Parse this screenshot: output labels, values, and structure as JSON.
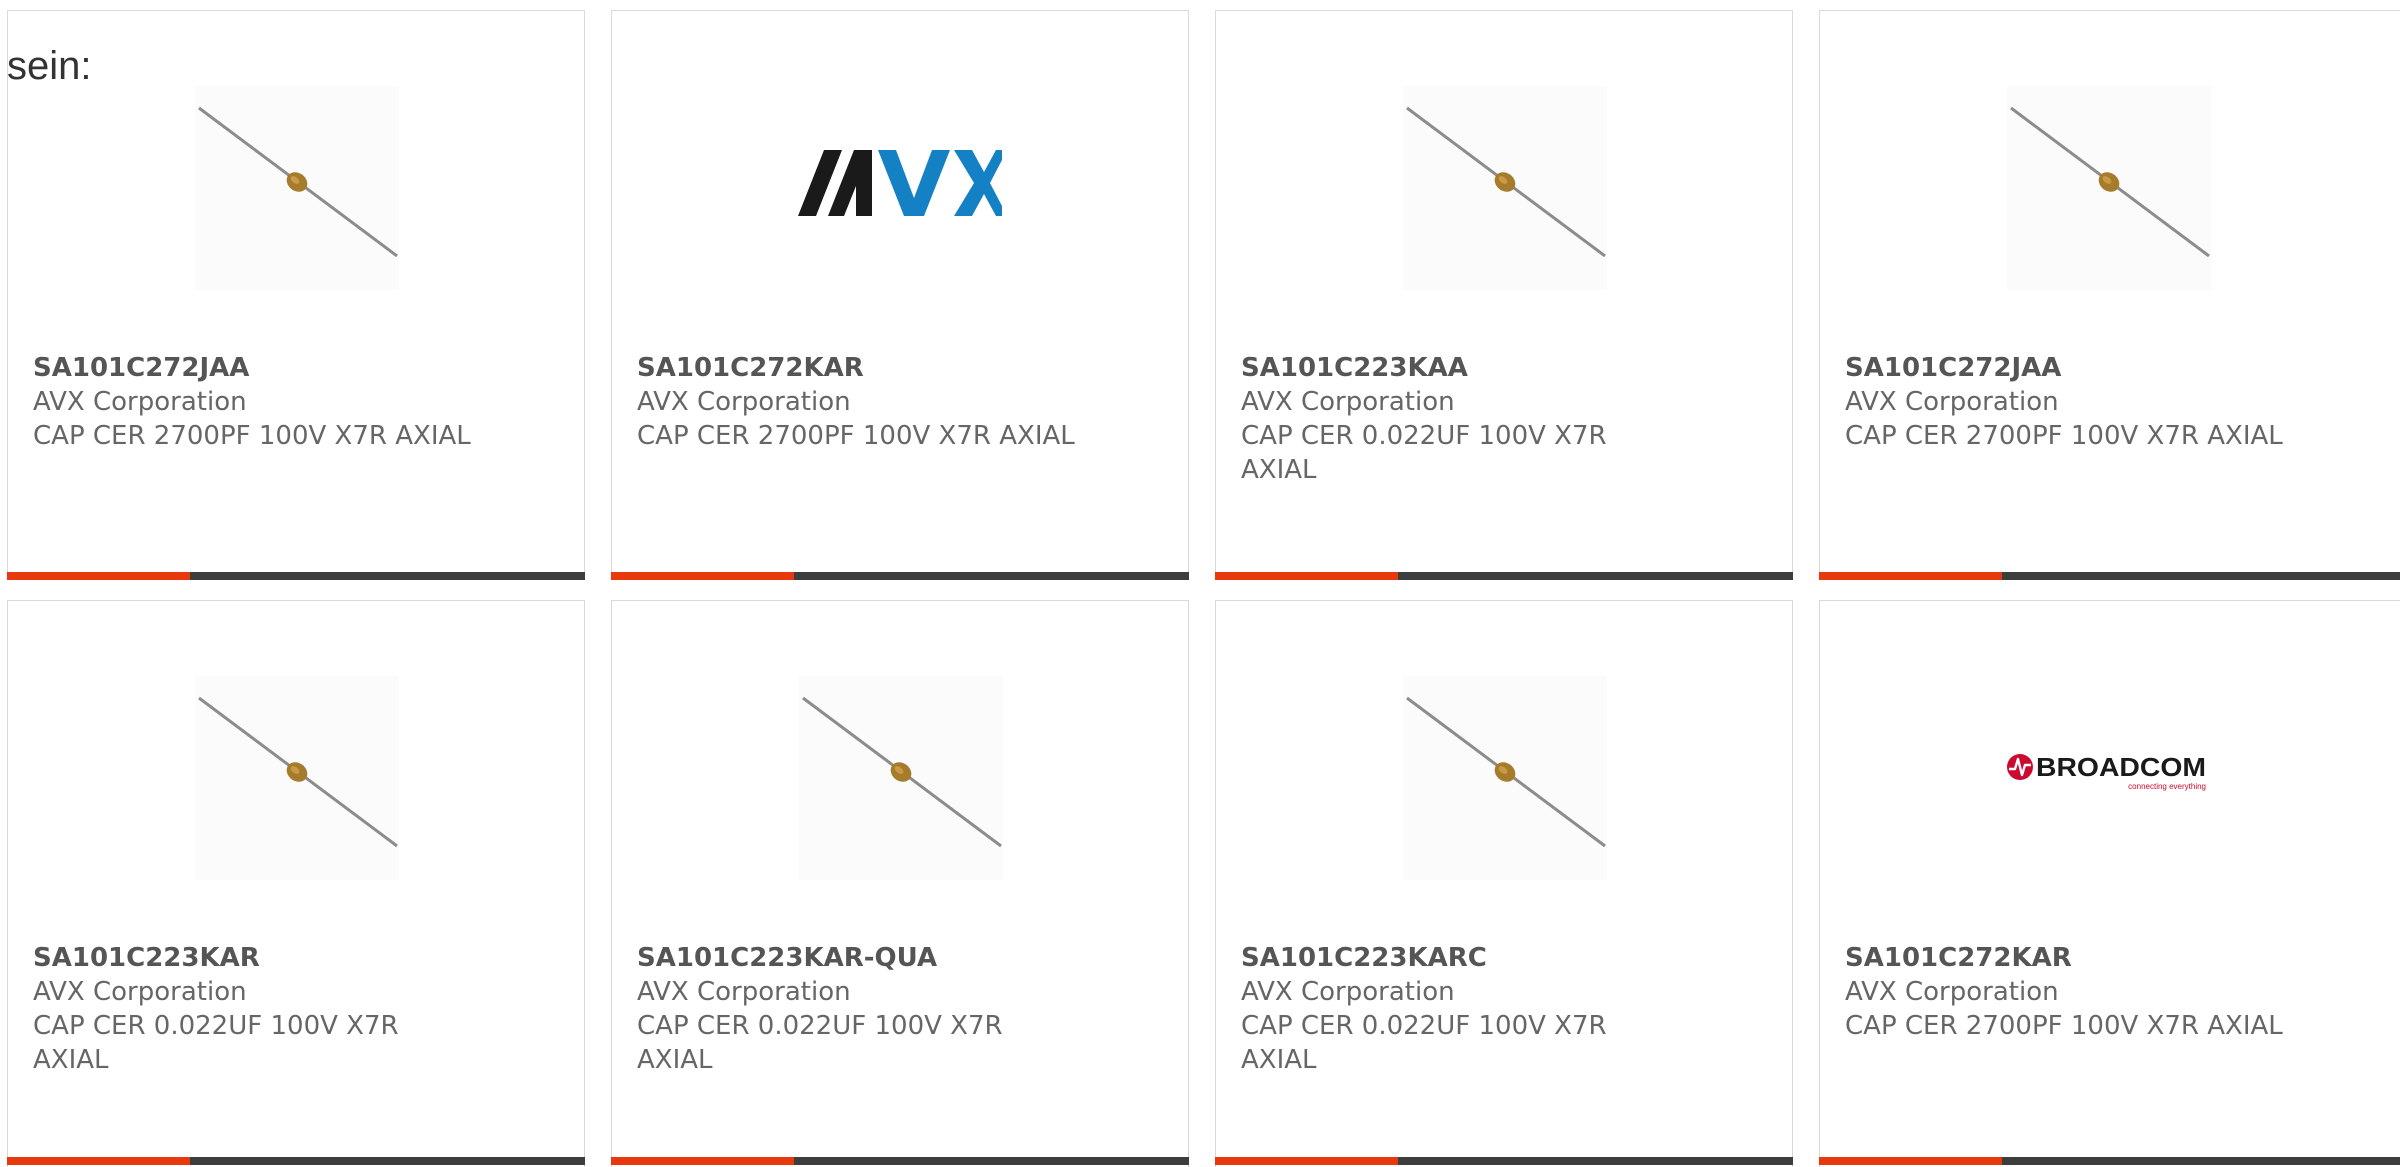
{
  "lead_text": "sein:",
  "colors": {
    "accent": "#e8380d",
    "bar": "#3d3d3d",
    "avx_dark": "#1a1a1a",
    "avx_blue": "#1581c5",
    "broadcom_red": "#cc092f"
  },
  "cards": [
    {
      "part": "SA101C272JAA",
      "manufacturer": "AVX Corporation",
      "description": "CAP CER 2700PF 100V X7R AXIAL",
      "image": "capacitor-photo"
    },
    {
      "part": "SA101C272KAR",
      "manufacturer": "AVX Corporation",
      "description": "CAP CER 2700PF 100V X7R AXIAL",
      "image": "avx-logo",
      "logo_text": "AVX"
    },
    {
      "part": "SA101C223KAA",
      "manufacturer": "AVX Corporation",
      "description": "CAP CER 0.022UF 100V X7R AXIAL",
      "image": "capacitor-photo"
    },
    {
      "part": "SA101C272JAA",
      "manufacturer": "AVX Corporation",
      "description": "CAP CER 2700PF 100V X7R AXIAL",
      "image": "capacitor-photo"
    },
    {
      "part": "SA101C223KAR",
      "manufacturer": "AVX Corporation",
      "description": "CAP CER 0.022UF 100V X7R AXIAL",
      "image": "capacitor-photo"
    },
    {
      "part": "SA101C223KAR-QUA",
      "manufacturer": "AVX Corporation",
      "description": "CAP CER 0.022UF 100V X7R AXIAL",
      "image": "capacitor-photo"
    },
    {
      "part": "SA101C223KARC",
      "manufacturer": "AVX Corporation",
      "description": "CAP CER 0.022UF 100V X7R AXIAL",
      "image": "capacitor-photo"
    },
    {
      "part": "SA101C272KAR",
      "manufacturer": "AVX Corporation",
      "description": "CAP CER 2700PF 100V X7R AXIAL",
      "image": "broadcom-logo",
      "logo_text": "BROADCOM",
      "logo_tagline": "connecting everything"
    }
  ]
}
